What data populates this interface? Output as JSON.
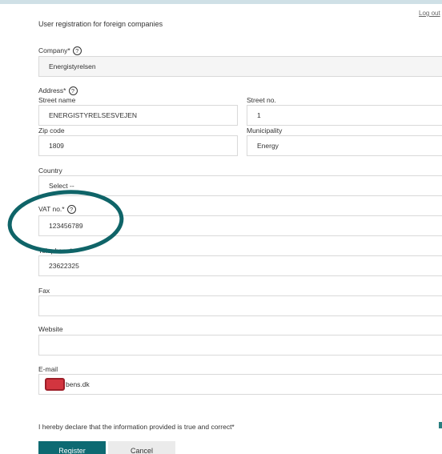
{
  "header": {
    "logout_label": "Log out",
    "title": "User registration for foreign companies"
  },
  "company": {
    "label": "Company*",
    "value": "Energistyrelsen"
  },
  "address": {
    "label": "Address*",
    "street_name_label": "Street name",
    "street_name_value": "ENERGISTYRELSESVEJEN",
    "street_no_label": "Street no.",
    "street_no_value": "1",
    "zip_label": "Zip code",
    "zip_value": "1809",
    "municipality_label": "Municipality",
    "municipality_value": "Energy"
  },
  "country": {
    "label": "Country",
    "value": "Select --"
  },
  "vat": {
    "label": "VAT no.*",
    "value": "123456789"
  },
  "telephone": {
    "label": "Telephone*",
    "value": "23622325"
  },
  "fax": {
    "label": "Fax",
    "value": ""
  },
  "website": {
    "label": "Website",
    "value": ""
  },
  "email": {
    "label": "E-mail",
    "value": "bens.dk"
  },
  "declaration": "I hereby declare that the information provided is true and correct*",
  "buttons": {
    "register": "Register",
    "cancel": "Cancel"
  },
  "help_glyph": "?",
  "colors": {
    "accent": "#0d6a72",
    "annotation_ring": "#0f6468",
    "redaction": "#d2353f"
  }
}
